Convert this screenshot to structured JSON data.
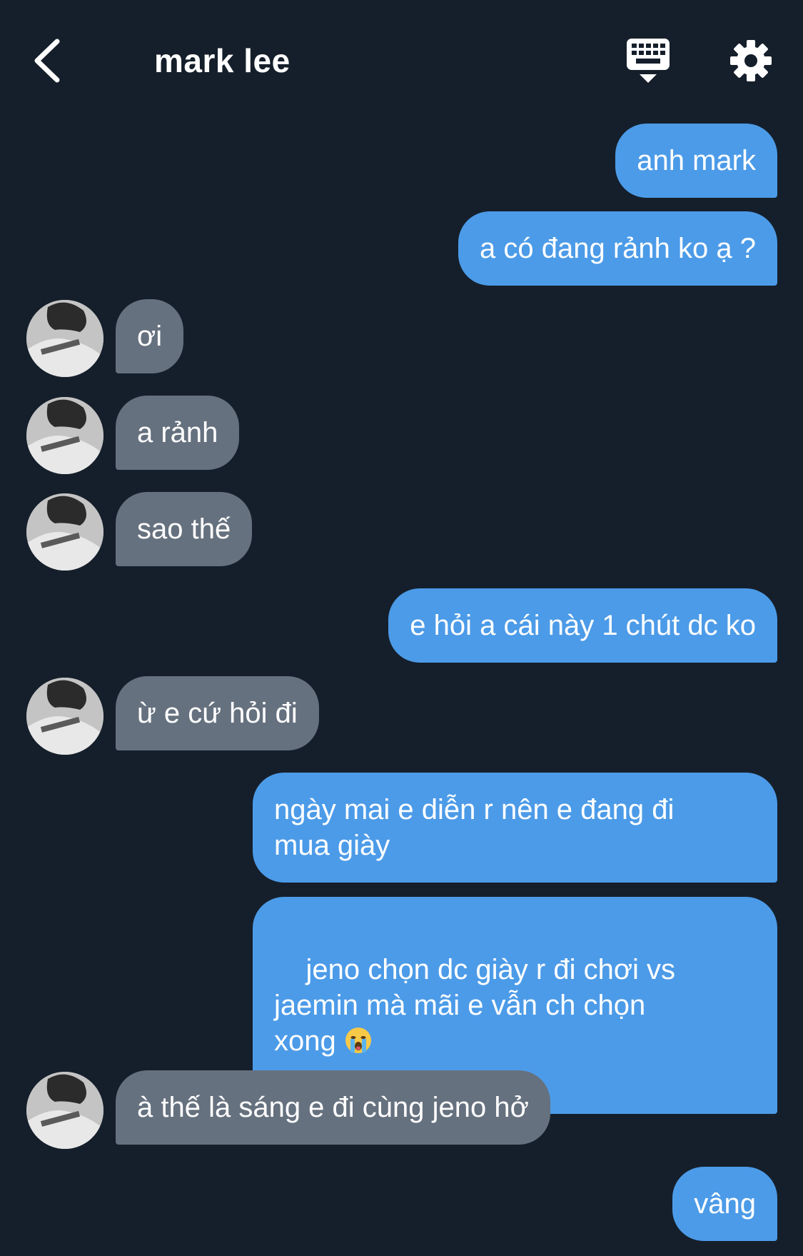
{
  "header": {
    "title": "mark lee",
    "icons": {
      "back": "chevron-left-icon",
      "keyboard": "keyboard-icon",
      "settings": "gear-icon"
    }
  },
  "messages": [
    {
      "side": "out",
      "text": "anh mark"
    },
    {
      "side": "out",
      "text": "a có đang rảnh ko ạ ?"
    },
    {
      "side": "in",
      "text": "ơi"
    },
    {
      "side": "in",
      "text": "a rảnh"
    },
    {
      "side": "in",
      "text": "sao thế"
    },
    {
      "side": "out",
      "text": "e hỏi a cái này 1 chút dc ko"
    },
    {
      "side": "in",
      "text": "ừ e cứ hỏi đi"
    },
    {
      "side": "out",
      "text": "ngày mai e diễn r nên e đang đi\nmua giày"
    },
    {
      "side": "out",
      "text": "jeno chọn dc giày r đi chơi vs\njaemin mà mãi e vẫn ch chọn\nxong",
      "emoji": "loudly-crying-face"
    },
    {
      "side": "in",
      "text": "à thế là sáng e đi cùng jeno hở"
    },
    {
      "side": "out",
      "text": "vâng"
    }
  ],
  "colors": {
    "background": "#151f2b",
    "outgoing_bubble": "#4c9be8",
    "incoming_bubble": "#66717f"
  }
}
